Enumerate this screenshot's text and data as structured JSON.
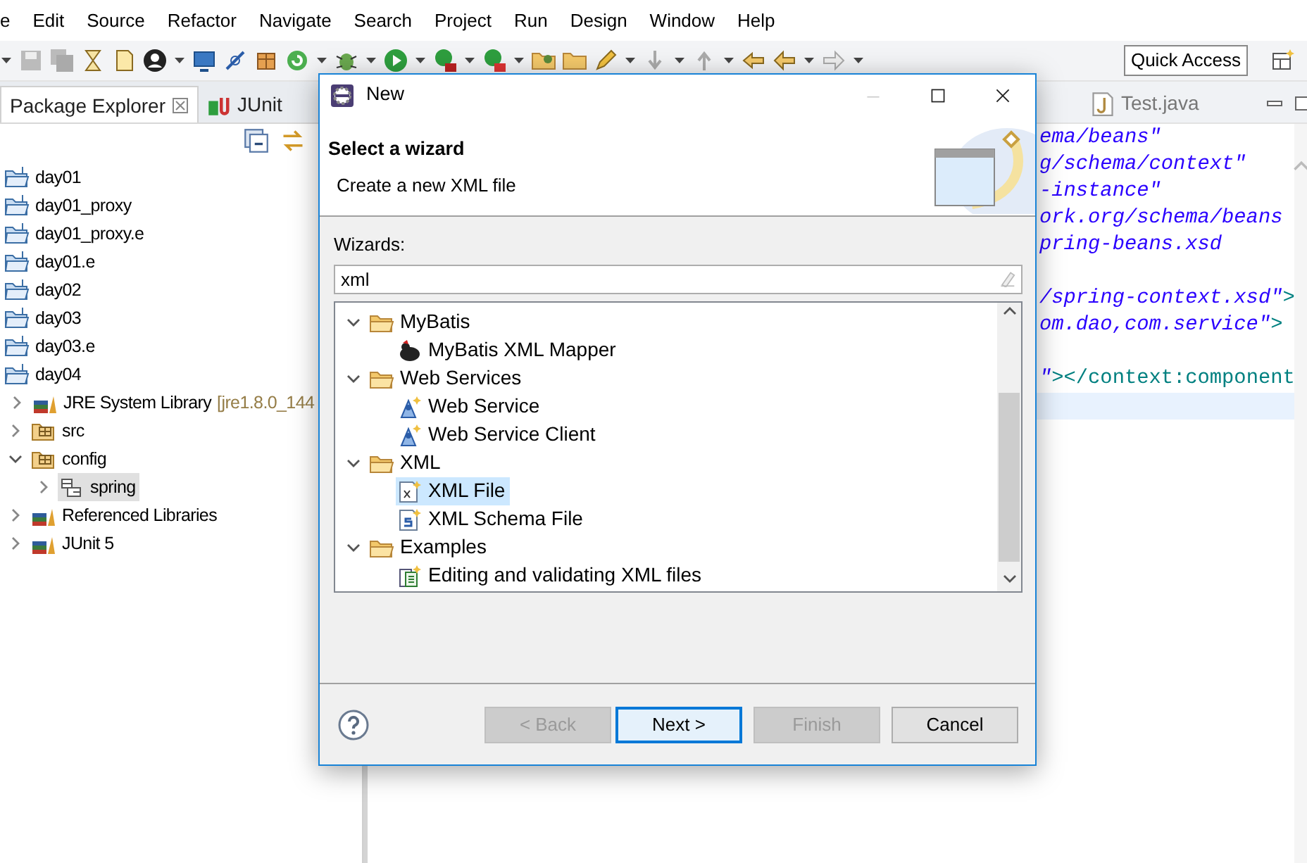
{
  "menu_bar": [
    {
      "label": "e"
    },
    {
      "label": "Edit"
    },
    {
      "label": "Source"
    },
    {
      "label": "Refactor"
    },
    {
      "label": "Navigate"
    },
    {
      "label": "Search"
    },
    {
      "label": "Project"
    },
    {
      "label": "Run"
    },
    {
      "label": "Design"
    },
    {
      "label": "Window"
    },
    {
      "label": "Help"
    }
  ],
  "toolbar": {
    "quick_access": "Quick Access"
  },
  "package_explorer": {
    "tabs": [
      {
        "label": "Package Explorer",
        "selected": true,
        "kind": "explorer"
      },
      {
        "label": "JUnit",
        "selected": false,
        "kind": "junit"
      }
    ],
    "tree": [
      {
        "label": "day01",
        "kind": "project",
        "selected": false
      },
      {
        "label": "day01_proxy",
        "kind": "project",
        "selected": false
      },
      {
        "label": "day01_proxy.e",
        "kind": "project",
        "selected": false
      },
      {
        "label": "day01.e",
        "kind": "project",
        "selected": false
      },
      {
        "label": "day02",
        "kind": "project",
        "selected": false
      },
      {
        "label": "day03",
        "kind": "project",
        "selected": false
      },
      {
        "label": "day03.e",
        "kind": "project",
        "selected": false
      },
      {
        "label": "day04",
        "kind": "project",
        "selected": false,
        "children": [
          {
            "label": "JRE System Library",
            "suffix": "[jre1.8.0_144",
            "kind": "library",
            "expanded": false,
            "selected": false
          },
          {
            "label": "src",
            "kind": "source-folder",
            "expanded": false,
            "selected": false
          },
          {
            "label": "config",
            "kind": "source-folder",
            "expanded": true,
            "selected": false,
            "children": [
              {
                "label": "spring",
                "kind": "package",
                "expanded": false,
                "selected": true
              }
            ]
          },
          {
            "label": "Referenced Libraries",
            "kind": "library",
            "expanded": false,
            "selected": false
          },
          {
            "label": "JUnit 5",
            "kind": "library",
            "expanded": false,
            "selected": false
          }
        ]
      }
    ]
  },
  "editor": {
    "tabs": [
      {
        "label": "Test.java",
        "selected": false
      }
    ],
    "lines": [
      {
        "kind": "code",
        "segments": [
          {
            "kind": "value",
            "text": "ema/beans\""
          }
        ]
      },
      {
        "kind": "code",
        "segments": [
          {
            "kind": "value",
            "text": "g/schema/context\""
          }
        ]
      },
      {
        "kind": "code",
        "segments": [
          {
            "kind": "value",
            "text": "-instance\""
          }
        ]
      },
      {
        "kind": "code",
        "segments": [
          {
            "kind": "value",
            "text": "ork.org/schema/beans"
          }
        ]
      },
      {
        "kind": "code",
        "segments": [
          {
            "kind": "value",
            "text": "pring-beans.xsd"
          }
        ]
      },
      {
        "kind": "blank"
      },
      {
        "kind": "code",
        "segments": [
          {
            "kind": "value",
            "text": "/spring-context.xsd\""
          },
          {
            "kind": "tag",
            "text": ">"
          }
        ]
      },
      {
        "kind": "code",
        "segments": [
          {
            "kind": "value",
            "text": "om.dao,com.service\""
          },
          {
            "kind": "tag",
            "text": ">"
          }
        ]
      },
      {
        "kind": "blank"
      },
      {
        "kind": "code",
        "segments": [
          {
            "kind": "value",
            "text": "\""
          },
          {
            "kind": "tag",
            "text": "></context:component"
          }
        ]
      },
      {
        "kind": "current"
      }
    ]
  },
  "dialog": {
    "title": "New",
    "heading": "Select a wizard",
    "description": "Create a new XML file",
    "filter_label": "Wizards:",
    "filter": {
      "value": "xml"
    },
    "wizards": [
      {
        "label": "MyBatis",
        "kind": "category",
        "expanded": true,
        "selected": false,
        "children": [
          {
            "label": "MyBatis XML Mapper",
            "kind": "mybatis",
            "selected": false
          }
        ]
      },
      {
        "label": "Web Services",
        "kind": "category",
        "expanded": true,
        "selected": false,
        "children": [
          {
            "label": "Web Service",
            "kind": "web-service",
            "selected": false
          },
          {
            "label": "Web Service Client",
            "kind": "web-service",
            "selected": false
          }
        ]
      },
      {
        "label": "XML",
        "kind": "category",
        "expanded": true,
        "selected": false,
        "children": [
          {
            "label": "XML File",
            "kind": "xml-file",
            "selected": true
          },
          {
            "label": "XML Schema File",
            "kind": "xml-schema",
            "selected": false
          }
        ]
      },
      {
        "label": "Examples",
        "kind": "category",
        "expanded": true,
        "selected": false,
        "children": [
          {
            "label": "Editing and validating XML files",
            "kind": "example",
            "selected": false
          }
        ]
      }
    ],
    "buttons": [
      {
        "label": "< Back",
        "disabled": true,
        "default": false
      },
      {
        "label": "Next >",
        "disabled": false,
        "default": true
      },
      {
        "label": "Finish",
        "disabled": true,
        "default": false
      },
      {
        "label": "Cancel",
        "disabled": false,
        "default": false
      }
    ]
  }
}
